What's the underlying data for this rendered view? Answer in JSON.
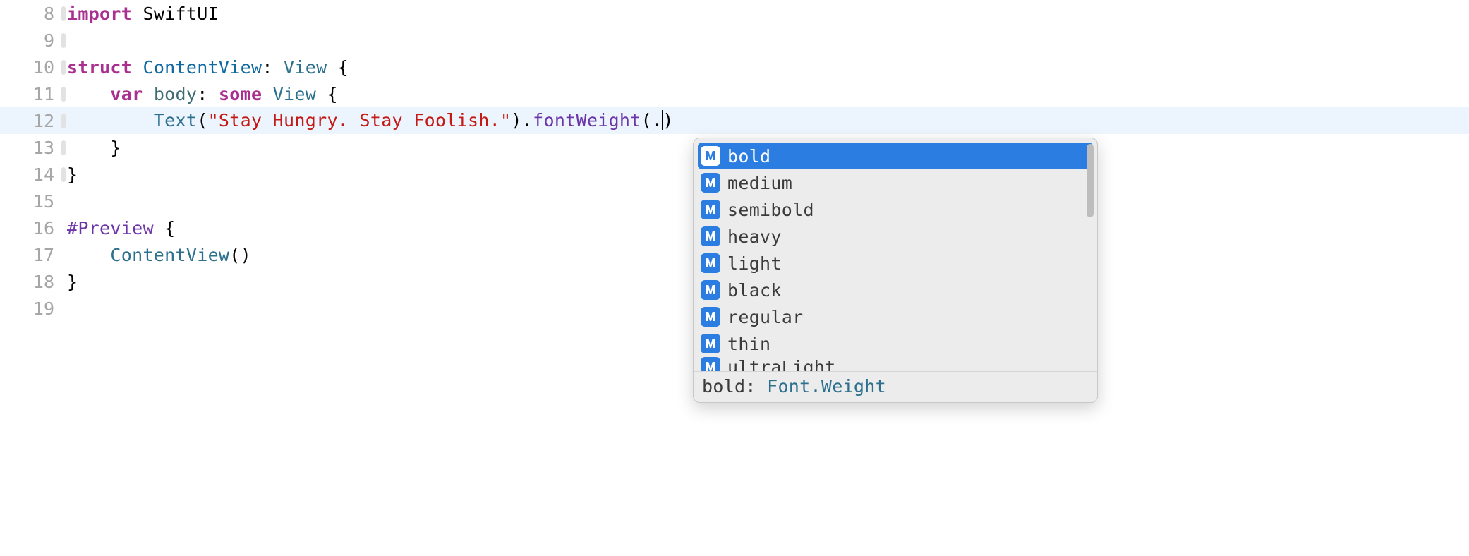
{
  "lines": [
    {
      "num": "8",
      "fold": true,
      "tokens": [
        [
          "keyword",
          "import"
        ],
        [
          "plain",
          " "
        ],
        [
          "plain",
          "SwiftUI"
        ]
      ]
    },
    {
      "num": "9",
      "fold": true,
      "tokens": []
    },
    {
      "num": "10",
      "fold": true,
      "tokens": [
        [
          "keyword",
          "struct"
        ],
        [
          "plain",
          " "
        ],
        [
          "typedecl",
          "ContentView"
        ],
        [
          "plain",
          ": "
        ],
        [
          "type",
          "View"
        ],
        [
          "plain",
          " {"
        ]
      ]
    },
    {
      "num": "11",
      "fold": true,
      "tokens": [
        [
          "plain",
          "    "
        ],
        [
          "keyword",
          "var"
        ],
        [
          "plain",
          " "
        ],
        [
          "ident",
          "body"
        ],
        [
          "plain",
          ": "
        ],
        [
          "some",
          "some"
        ],
        [
          "plain",
          " "
        ],
        [
          "type",
          "View"
        ],
        [
          "plain",
          " {"
        ]
      ]
    },
    {
      "num": "12",
      "fold": true,
      "highlight": true,
      "hasCursor": true,
      "tokens": [
        [
          "plain",
          "        "
        ],
        [
          "callname",
          "Text"
        ],
        [
          "plain",
          "("
        ],
        [
          "string",
          "\"Stay Hungry. Stay Foolish.\""
        ],
        [
          "plain",
          ")."
        ],
        [
          "method",
          "fontWeight"
        ],
        [
          "plain",
          "(."
        ]
      ],
      "afterCursor": ")"
    },
    {
      "num": "13",
      "fold": true,
      "tokens": [
        [
          "plain",
          "    }"
        ]
      ]
    },
    {
      "num": "14",
      "fold": true,
      "tokens": [
        [
          "plain",
          "}"
        ]
      ]
    },
    {
      "num": "15",
      "fold": false,
      "tokens": []
    },
    {
      "num": "16",
      "fold": false,
      "tokens": [
        [
          "preview",
          "#Preview"
        ],
        [
          "plain",
          " {"
        ]
      ]
    },
    {
      "num": "17",
      "fold": false,
      "tokens": [
        [
          "plain",
          "    "
        ],
        [
          "callname",
          "ContentView"
        ],
        [
          "plain",
          "()"
        ]
      ]
    },
    {
      "num": "18",
      "fold": false,
      "tokens": [
        [
          "plain",
          "}"
        ]
      ]
    },
    {
      "num": "19",
      "fold": false,
      "tokens": []
    }
  ],
  "autocomplete": {
    "iconLetter": "M",
    "items": [
      {
        "label": "bold",
        "selected": true
      },
      {
        "label": "medium"
      },
      {
        "label": "semibold"
      },
      {
        "label": "heavy"
      },
      {
        "label": "light"
      },
      {
        "label": "black"
      },
      {
        "label": "regular"
      },
      {
        "label": "thin"
      },
      {
        "label": "ultraLight",
        "cutoff": true
      }
    ],
    "footer": {
      "name": "bold",
      "sep": ": ",
      "type": "Font.Weight"
    }
  }
}
